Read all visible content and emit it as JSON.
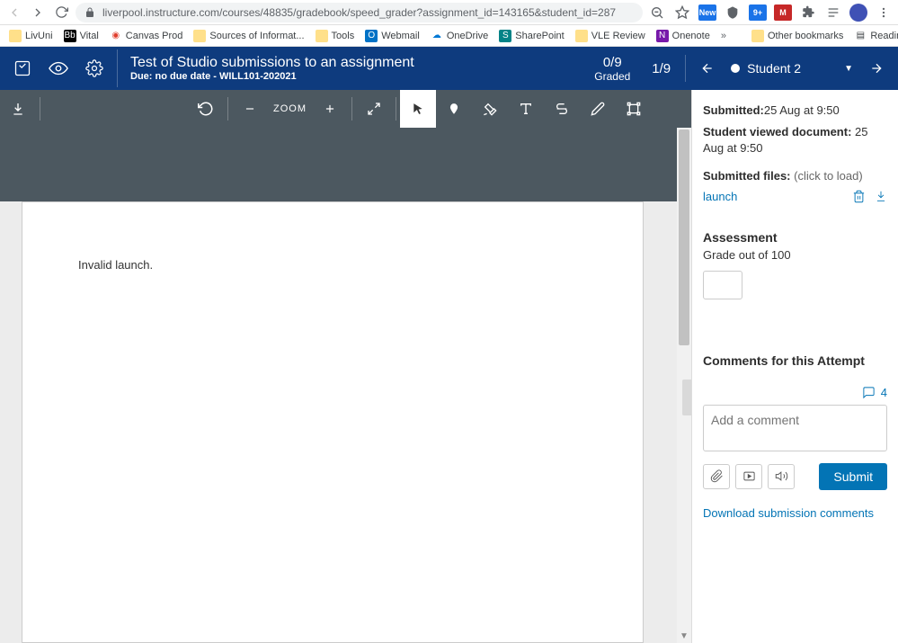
{
  "chrome": {
    "url": "liverpool.instructure.com/courses/48835/gradebook/speed_grader?assignment_id=143165&student_id=287",
    "ext_new": "New",
    "ext_m": "M",
    "ext_9": "9+"
  },
  "bookmarks": {
    "b1": "LivUni",
    "b2": "Vital",
    "b3": "Canvas Prod",
    "b4": "Sources of Informat...",
    "b5": "Tools",
    "b6": "Webmail",
    "b7": "OneDrive",
    "b8": "SharePoint",
    "b9": "VLE Review",
    "b10": "Onenote",
    "other": "Other bookmarks",
    "reading": "Reading list"
  },
  "header": {
    "title": "Test of Studio submissions to an assignment",
    "subtitle": "Due: no due date - WILL101-202021",
    "graded_count": "0/9",
    "graded_label": "Graded",
    "position": "1/9",
    "student": "Student 2"
  },
  "toolbar": {
    "zoom": "ZOOM"
  },
  "document": {
    "content": "Invalid launch."
  },
  "side": {
    "submitted_label": "Submitted:",
    "submitted_val": "25 Aug at 9:50",
    "viewed_label": "Student viewed document:",
    "viewed_val": " 25 Aug at 9:50",
    "files_label": "Submitted files:",
    "files_hint": " (click to load)",
    "file_name": "launch",
    "assessment_h": "Assessment",
    "grade_label": "Grade out of 100",
    "comments_h": "Comments for this Attempt",
    "comments_count": "4",
    "comment_placeholder": "Add a comment",
    "submit": "Submit",
    "download_comments": "Download submission comments"
  }
}
